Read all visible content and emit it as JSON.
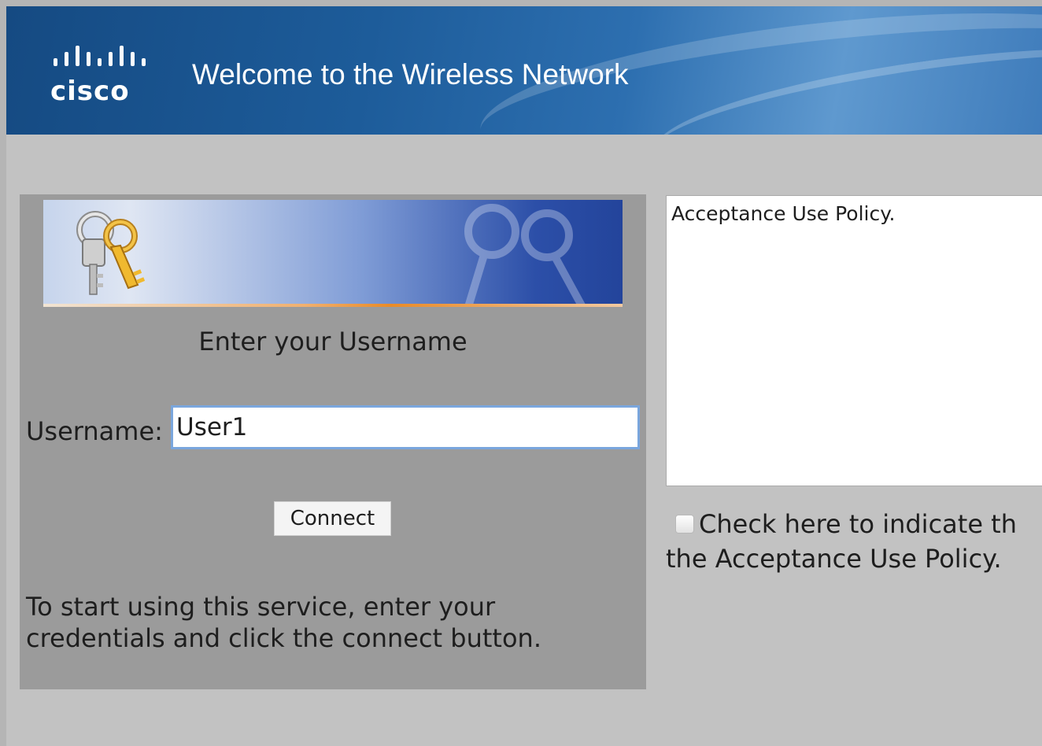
{
  "header": {
    "logo_text": "cisco",
    "title": "Welcome to the Wireless Network"
  },
  "login": {
    "heading": "Enter your Username",
    "username_label": "Username:",
    "username_value": "User1",
    "connect_label": "Connect",
    "instructions": "To start using this service, enter your credentials and click the connect button."
  },
  "policy": {
    "text": "Acceptance Use Policy.",
    "checkbox_checked": false,
    "checkbox_label_line1": "Check here to indicate th",
    "checkbox_label_line2": "the Acceptance Use Policy."
  },
  "icons": {
    "logo": "cisco-logo-icon",
    "keys": "keys-icon",
    "watermark": "keys-watermark-icon"
  },
  "colors": {
    "header_blue": "#1d5c9a",
    "panel_gray": "#9b9b9b",
    "page_gray": "#c2c2c2",
    "input_focus_border": "#7aa6dd",
    "accent_orange": "#e98b28"
  }
}
